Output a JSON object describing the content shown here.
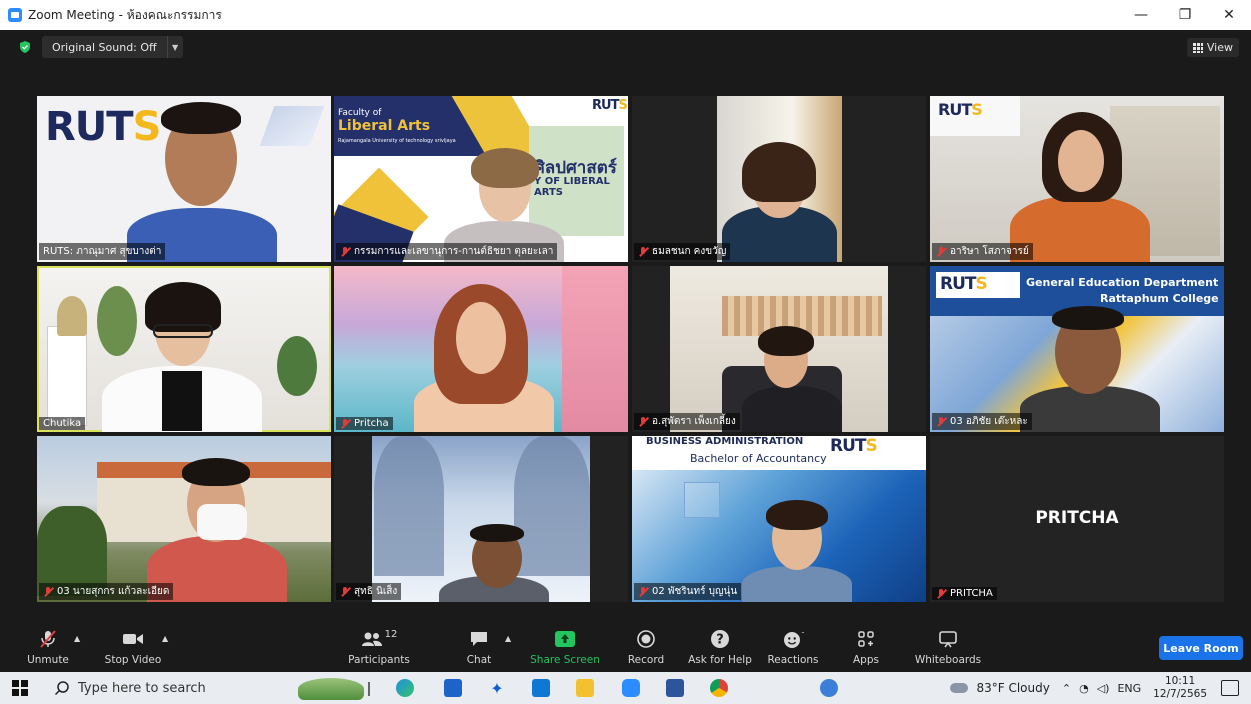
{
  "window": {
    "title": "Zoom Meeting - ห้องคณะกรรมการ",
    "controls": {
      "minimize": "—",
      "maximize": "❐",
      "close": "✕"
    }
  },
  "topbar": {
    "original_sound": "Original Sound: Off",
    "view_label": "View"
  },
  "tiles": [
    {
      "name": "RUTS: ภาณุมาศ สุขบางต่า",
      "muted": false
    },
    {
      "name": "กรรมการและเลขานุการ-กานต์ธิชยา ตุลยะเลา",
      "muted": true,
      "overlay_small": "Faculty of",
      "overlay_big": "Liberal Arts",
      "overlay_sub": "Rajamangala University of technology srivijaya",
      "overlay_thai": "ศิลปศาสตร์",
      "overlay_eng": "Y OF LIBERAL ARTS",
      "logo": "RUTS"
    },
    {
      "name": "ธมลชนก คงขวัญ",
      "muted": true
    },
    {
      "name": "อาริษา โสภาจารย์",
      "muted": true,
      "logo": "RUTS"
    },
    {
      "name": "Chutika",
      "muted": false
    },
    {
      "name": "Pritcha",
      "muted": true
    },
    {
      "name": "อ.สุพัตรา เพ็งเกลี้ยง",
      "muted": true
    },
    {
      "name": "03 อภิชัย เต๊ะหละ",
      "muted": true,
      "overlay_line1": "General Education Department",
      "overlay_line2": "Rattaphum College",
      "logo": "RUTS"
    },
    {
      "name": "03 นายสุกกร แก้วละเอียด",
      "muted": true
    },
    {
      "name": "สุทธิ นิเส็ง",
      "muted": true
    },
    {
      "name": "02 พัชรินทร์ บุญนุ่น",
      "muted": true,
      "overlay_line1": "BUSINESS ADMINISTRATION",
      "overlay_line2": "Bachelor of Accountancy",
      "logo": "RUTS"
    },
    {
      "name": "PRITCHA",
      "muted": true,
      "center_text": "PRITCHA"
    }
  ],
  "toolbar": {
    "unmute": "Unmute",
    "stop_video": "Stop Video",
    "participants": "Participants",
    "participants_count": "12",
    "chat": "Chat",
    "share_screen": "Share Screen",
    "record": "Record",
    "ask_for_help": "Ask for Help",
    "reactions": "Reactions",
    "apps": "Apps",
    "whiteboards": "Whiteboards",
    "leave_room": "Leave Room"
  },
  "taskbar": {
    "search_placeholder": "Type here to search",
    "weather": "83°F  Cloudy",
    "language": "ENG",
    "time": "10:11",
    "date": "12/7/2565"
  },
  "colors": {
    "accent_blue": "#1a73e8",
    "share_green": "#22c55e",
    "muted_red": "#e23b3b",
    "active_speaker": "#d9e35a"
  }
}
